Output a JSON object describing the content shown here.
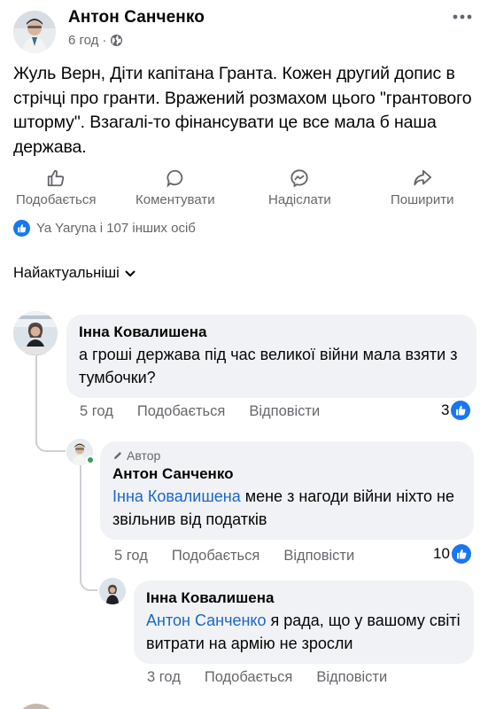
{
  "post": {
    "author": "Антон Санченко",
    "time": "6 год",
    "text": "Жуль Верн, Діти капітана Гранта. Кожен другий допис в стрічці про гранти. Вражений розмахом цього \"грантового шторму\". Взагалі-то фінансувати це все мала б наша держава.",
    "globe_icon": "globe-icon",
    "more_icon": "more-dots-icon"
  },
  "actions": {
    "like": "Подобається",
    "comment": "Коментувати",
    "send": "Надіслати",
    "share": "Поширити"
  },
  "reactions": {
    "summary": "Ya Yaryna і 107 інших осіб",
    "icon": "like-reaction-icon"
  },
  "sort": {
    "label": "Найактуальніші"
  },
  "comments": [
    {
      "author": "Інна Ковалишена",
      "text": "а гроші держава під час великої війни мала взяти з тумбочки?",
      "time": "5 год",
      "like_label": "Подобається",
      "reply_label": "Відповісти",
      "likes": "3"
    },
    {
      "badge": "Автор",
      "author": "Антон Санченко",
      "mention": "Інна Ковалишена",
      "text": " мене з нагоди війни ніхто не звільнив від податків",
      "time": "5 год",
      "like_label": "Подобається",
      "reply_label": "Відповісти",
      "likes": "10"
    },
    {
      "author": "Інна Ковалишена",
      "mention": "Антон Санченко",
      "text": " я рада, що у вашому світі витрати на армію не зросли",
      "time": "3 год",
      "like_label": "Подобається",
      "reply_label": "Відповісти"
    }
  ],
  "colors": {
    "link": "#1a67c7",
    "facebook_blue": "#1877f2",
    "secondary_text": "#65676b",
    "bubble": "#f0f2f5",
    "online": "#31a24c"
  }
}
